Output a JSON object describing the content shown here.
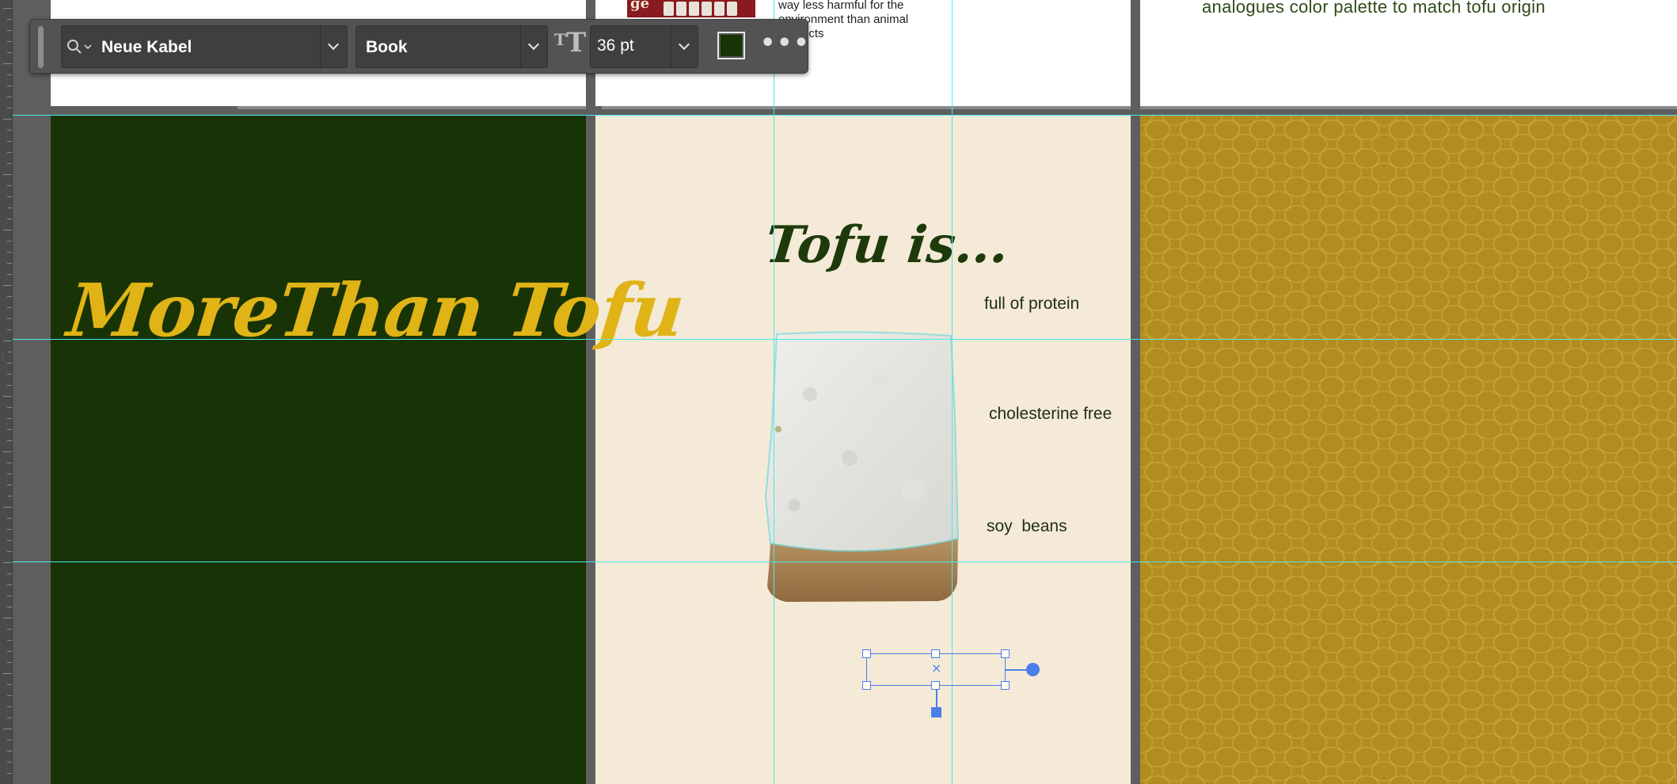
{
  "toolbar": {
    "font_family": "Neue Kabel",
    "font_style": "Book",
    "font_size": "36 pt",
    "fill_color": "#183305"
  },
  "top_row": {
    "bullet_text": "way less harmful for the environment than animal products",
    "palette_text": "analogues color palette to match tofu origin",
    "image_label": "ge"
  },
  "left_artboard": {
    "title": "MoreThan Tofu",
    "background": "#183305",
    "title_color": "#e0b316"
  },
  "middle_artboard": {
    "heading": "Tofu is...",
    "facts": [
      "full of protein",
      "cholesterine free",
      "soy  beans"
    ],
    "background": "#f4ead7"
  },
  "right_artboard": {
    "background": "#b08c21"
  },
  "colors": {
    "guide": "#4fe8ea",
    "selection": "#4b7ee8"
  }
}
